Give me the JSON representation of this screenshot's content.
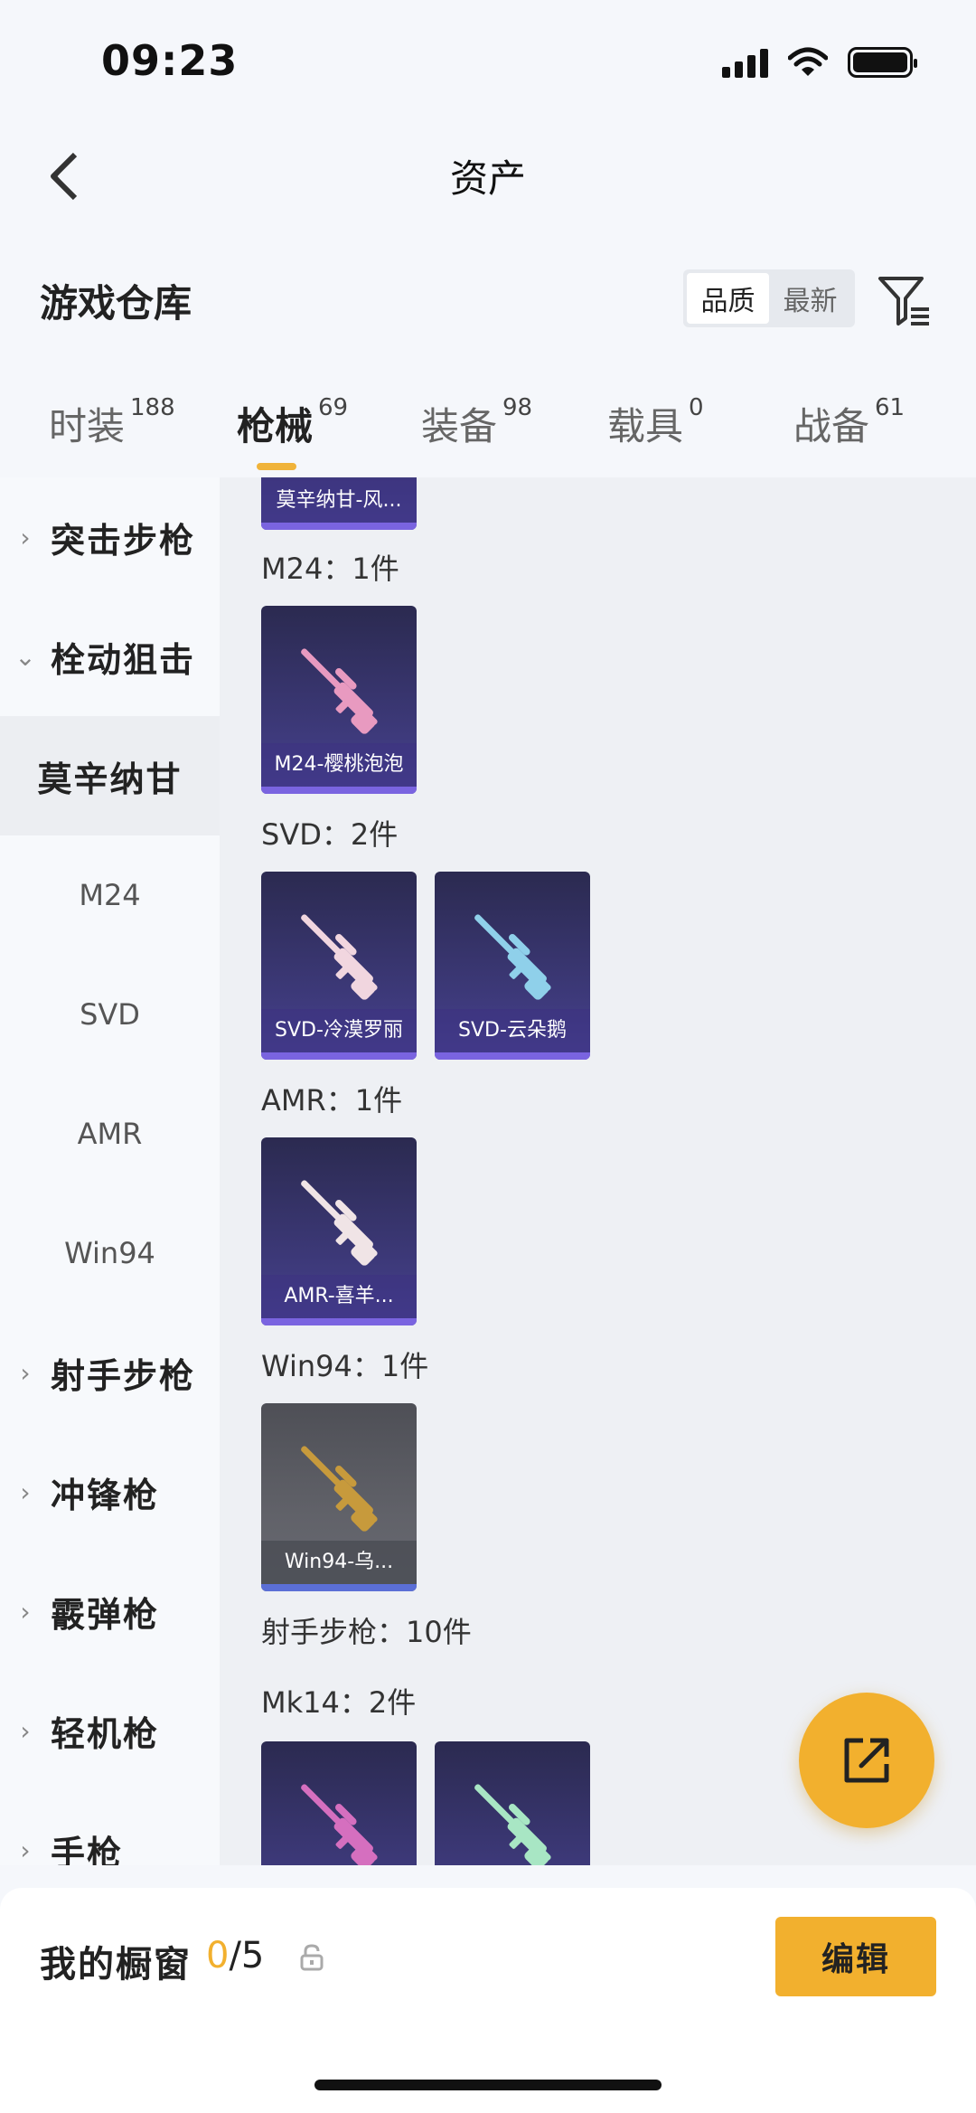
{
  "status_bar": {
    "time": "09:23"
  },
  "nav": {
    "title": "资产"
  },
  "warehouse": {
    "title": "游戏仓库",
    "sort_options": [
      "品质",
      "最新"
    ],
    "sort_selected": "品质"
  },
  "tabs": [
    {
      "label": "时装",
      "count": "188"
    },
    {
      "label": "枪械",
      "count": "69",
      "active": true
    },
    {
      "label": "装备",
      "count": "98"
    },
    {
      "label": "载具",
      "count": "0"
    },
    {
      "label": "战备",
      "count": "61"
    }
  ],
  "sidebar": {
    "categories": [
      {
        "label": "突击步枪",
        "expanded": false
      },
      {
        "label": "栓动狙击",
        "expanded": true
      },
      {
        "label": "射手步枪",
        "expanded": false
      },
      {
        "label": "冲锋枪",
        "expanded": false
      },
      {
        "label": "霰弹枪",
        "expanded": false
      },
      {
        "label": "轻机枪",
        "expanded": false
      },
      {
        "label": "手枪",
        "expanded": false
      }
    ],
    "subitems": [
      "莫辛纳甘",
      "M24",
      "SVD",
      "AMR",
      "Win94"
    ],
    "selected_sub": "莫辛纳甘"
  },
  "content": {
    "partial_top_card": "莫辛纳甘-风...",
    "groups": [
      {
        "label": "M24：1件",
        "items": [
          {
            "name": "M24-樱桃泡泡",
            "gun_color": "#e89ac0"
          }
        ]
      },
      {
        "label": "SVD：2件",
        "items": [
          {
            "name": "SVD-冷漠罗丽",
            "gun_color": "#f1d6df"
          },
          {
            "name": "SVD-云朵鹅",
            "gun_color": "#8fd0ea"
          }
        ]
      },
      {
        "label": "AMR：1件",
        "items": [
          {
            "name": "AMR-喜羊...",
            "gun_color": "#f0e4e6"
          }
        ]
      },
      {
        "label": "Win94：1件",
        "items": [
          {
            "name": "Win94-乌...",
            "gun_color": "#c79a3c"
          }
        ]
      }
    ],
    "section_label": "射手步枪：10件",
    "mk14_label": "Mk14：2件",
    "mk14_colors": [
      "#d56fbf",
      "#a8e6c4"
    ]
  },
  "bottom": {
    "showcase_label": "我的橱窗",
    "showcase_current": "0",
    "showcase_total": "/5",
    "edit_label": "编辑"
  },
  "colors": {
    "accent": "#f2b02e",
    "card_purple": "#3e3a7c"
  }
}
